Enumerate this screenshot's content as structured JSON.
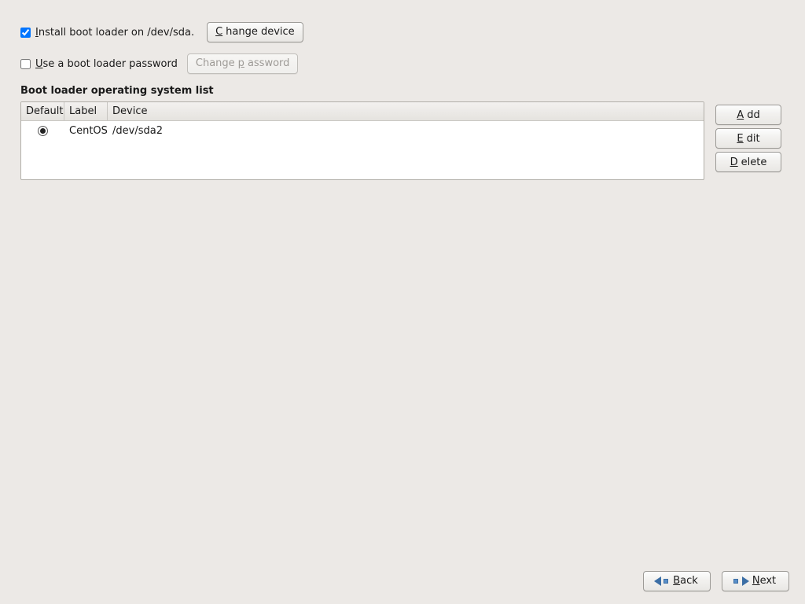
{
  "install_checkbox": {
    "checked": true,
    "label_prefix": "I",
    "label_rest": "nstall boot loader on /dev/sda."
  },
  "change_device_btn": {
    "mn": "C",
    "rest": "hange device"
  },
  "password_checkbox": {
    "checked": false,
    "label_prefix": "U",
    "label_rest": "se a boot loader password"
  },
  "change_password_btn": {
    "mn": "p",
    "before": "Change ",
    "rest": "assword"
  },
  "section_title": "Boot loader operating system list",
  "columns": {
    "default": "Default",
    "label": "Label",
    "device": "Device"
  },
  "rows": [
    {
      "default": true,
      "label": "CentOS",
      "device": "/dev/sda2"
    }
  ],
  "side": {
    "add": {
      "mn": "A",
      "rest": "dd"
    },
    "edit": {
      "mn": "E",
      "rest": "dit"
    },
    "del": {
      "mn": "D",
      "rest": "elete"
    }
  },
  "nav": {
    "back": {
      "mn": "B",
      "rest": "ack"
    },
    "next": {
      "mn": "N",
      "rest": "ext"
    }
  }
}
